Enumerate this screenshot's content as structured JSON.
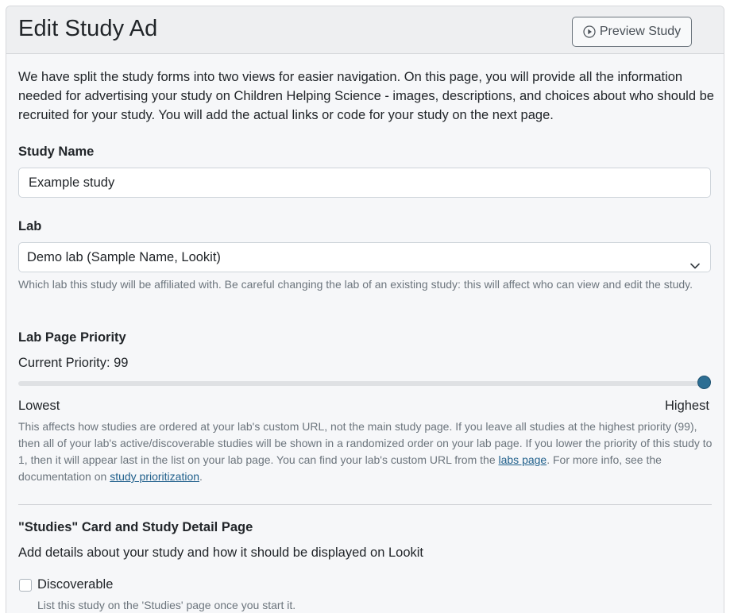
{
  "header": {
    "title": "Edit Study Ad",
    "preview_button": {
      "label": "Preview Study",
      "icon": "play-circle-icon"
    }
  },
  "intro": "We have split the study forms into two views for easier navigation. On this page, you will provide all the information needed for advertising your study on Children Helping Science - images, descriptions, and choices about who should be recruited for your study. You will add the actual links or code for your study on the next page.",
  "study_name": {
    "label": "Study Name",
    "value": "Example study"
  },
  "lab": {
    "label": "Lab",
    "selected": "Demo lab (Sample Name, Lookit)",
    "help": "Which lab this study will be affiliated with. Be careful changing the lab of an existing study: this will affect who can view and edit the study."
  },
  "priority": {
    "label": "Lab Page Priority",
    "current_text": "Current Priority: 99",
    "value": 99,
    "min": 1,
    "max": 99,
    "low_label": "Lowest",
    "high_label": "Highest",
    "help_before_link1": "This affects how studies are ordered at your lab's custom URL, not the main study page. If you leave all studies at the highest priority (99), then all of your lab's active/discoverable studies will be shown in a randomized order on your lab page. If you lower the priority of this study to 1, then it will appear last in the list on your lab page. You can find your lab's custom URL from the ",
    "link1": "labs page",
    "help_between": ". For more info, see the documentation on ",
    "link2": "study prioritization",
    "help_after": "."
  },
  "studies_card": {
    "heading": "\"Studies\" Card and Study Detail Page",
    "subheading": "Add details about your study and how it should be displayed on Lookit",
    "discoverable": {
      "label": "Discoverable",
      "checked": false,
      "help": "List this study on the 'Studies' page once you start it."
    }
  },
  "colors": {
    "accent": "#2d6e93",
    "link": "#1f5f8b",
    "muted_text": "#6c757d"
  }
}
